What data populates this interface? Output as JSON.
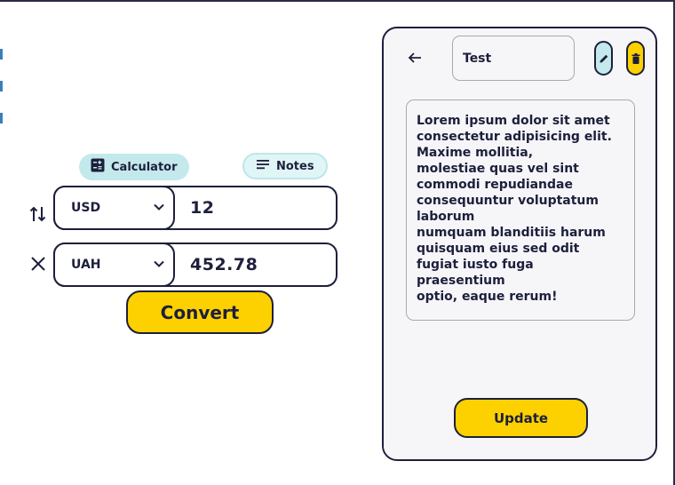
{
  "converter": {
    "modes": {
      "calculator_label": "Calculator",
      "notes_label": "Notes"
    },
    "from": {
      "currency": "USD",
      "amount": "12"
    },
    "to": {
      "currency": "UAH",
      "amount": "452.78"
    },
    "convert_label": "Convert",
    "icons": {
      "swap": "swap-vertical-icon",
      "multiply": "multiply-icon",
      "dropdown": "chevron-down-icon",
      "calculator": "calculator-icon",
      "notes": "lines-icon"
    }
  },
  "note_editor": {
    "title": "Test",
    "body": "Lorem ipsum dolor sit amet consectetur adipisicing elit.\nMaxime mollitia,\nmolestiae quas vel sint commodi repudiandae consequuntur voluptatum laborum\nnumquam blanditiis harum quisquam eius sed odit fugiat iusto fuga praesentium\noptio, eaque rerum!",
    "update_label": "Update",
    "icons": {
      "back": "arrow-left-icon",
      "edit": "pencil-icon",
      "delete": "trash-icon"
    }
  },
  "colors": {
    "accent_yellow": "#fdd100",
    "accent_teal": "#c3e9ec",
    "ink": "#1d1f3b",
    "panel_bg": "#f6f6f9"
  }
}
